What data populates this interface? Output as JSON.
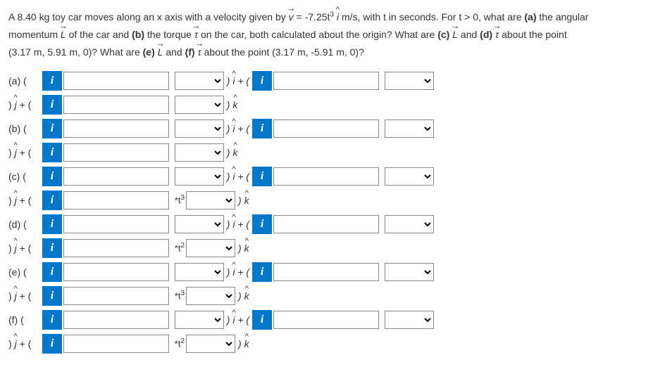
{
  "question": {
    "line1_a": "A 8.40 kg toy car moves along an x axis with a velocity given by ",
    "line1_v": "v",
    "line1_b": " = -7.25t",
    "line1_exp": "3",
    "line1_c": " ",
    "line1_i": "i",
    "line1_d": " m/s, with t in seconds. For t > 0, what are ",
    "line1_bold_a": "(a)",
    "line1_e": " the angular",
    "line2_a": "momentum ",
    "line2_L": "L",
    "line2_b": " of the car and ",
    "line2_bold_b": "(b)",
    "line2_c": " the torque ",
    "line2_tau": "τ",
    "line2_d": " on the car, both calculated about the origin? What are ",
    "line2_bold_c": "(c)",
    "line2_e": " ",
    "line2_L2": "L",
    "line2_f": " and ",
    "line2_bold_d": "(d)",
    "line2_g": " ",
    "line2_tau2": "τ",
    "line2_h": " about the point",
    "line3_a": "(3.17 m, 5.91 m, 0)? What are ",
    "line3_bold_e": "(e)",
    "line3_b": " ",
    "line3_L": "L",
    "line3_c": " and ",
    "line3_bold_f": "(f)",
    "line3_d": " ",
    "line3_tau": "τ",
    "line3_e": " about the point (3.17 m, -5.91 m, 0)?"
  },
  "parts": {
    "a": {
      "label": "(a) (",
      "prefix": ""
    },
    "a2": {
      "label": ") ",
      "j": "j",
      "plus": " + (",
      "prefix": ""
    },
    "b": {
      "label": "(b) (",
      "prefix": ""
    },
    "b2": {
      "label": ") ",
      "j": "j",
      "plus": " + (",
      "prefix": ""
    },
    "c": {
      "label": "(c) (",
      "prefix": ""
    },
    "c2": {
      "label": ") ",
      "j": "j",
      "plus": " + (",
      "prefix": "*t",
      "exp": "3"
    },
    "d": {
      "label": "(d) (",
      "prefix": ""
    },
    "d2": {
      "label": ") ",
      "j": "j",
      "plus": " + (",
      "prefix": "*t",
      "exp": "2"
    },
    "e": {
      "label": "(e) (",
      "prefix": ""
    },
    "e2": {
      "label": ") ",
      "j": "j",
      "plus": " + (",
      "prefix": "*t",
      "exp": "3"
    },
    "f": {
      "label": "(f) (",
      "prefix": ""
    },
    "f2": {
      "label": ") ",
      "j": "j",
      "plus": " + (",
      "prefix": "*t",
      "exp": "2"
    }
  },
  "frag": {
    "i_plus": " + ( ",
    "close_i": " ) ",
    "i": "i",
    "k": "k",
    "close_k": " ) ",
    "tooltip": "i"
  }
}
